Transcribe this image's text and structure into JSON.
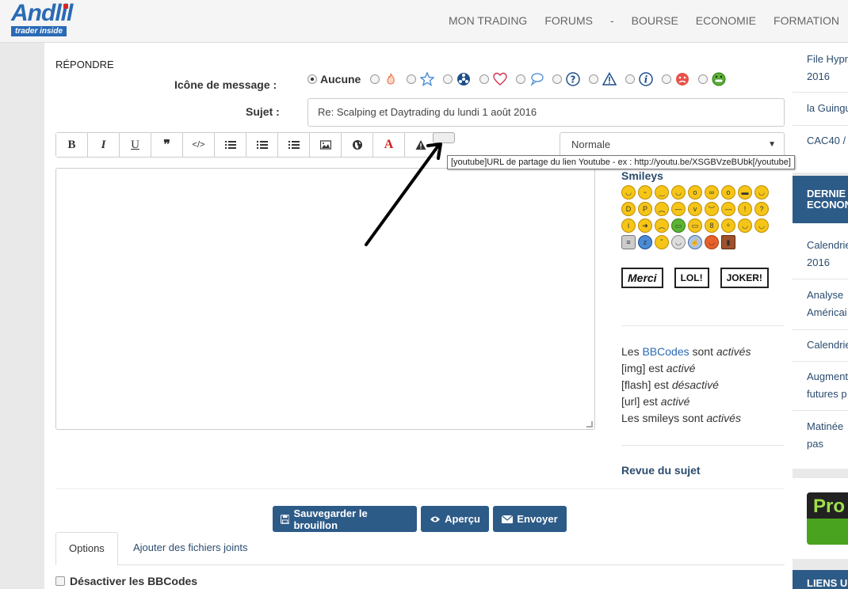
{
  "logo": {
    "line1": "Andlil",
    "line2": "trader inside"
  },
  "nav": [
    "MON TRADING",
    "FORUMS",
    "-",
    "BOURSE",
    "ECONOMIE",
    "FORMATION"
  ],
  "form": {
    "title": "RÉPONDRE",
    "icon_label": "Icône de message :",
    "icon_none": "Aucune",
    "subject_label": "Sujet :",
    "subject_value": "Re: Scalping et Daytrading du lundi 1 août 2016",
    "font_size": "Normale",
    "tooltip": "[youtube]URL de partage du lien Youtube - ex : http://youtu.be/XSGBVzeBUbk[/youtube]"
  },
  "toolbar": {
    "bold": "B",
    "italic": "I",
    "underline": "U",
    "quote": "❞",
    "code": "</>",
    "color": "A"
  },
  "smileys": {
    "title": "Smileys",
    "signs": [
      "Merci",
      "LOL!",
      "JOKER!"
    ]
  },
  "bbinfo": {
    "line1_prefix": "Les ",
    "line1_link": "BBCodes",
    "line1_mid": " sont ",
    "line1_state": "activés",
    "line2_prefix": "[img] est ",
    "line2_state": "activé",
    "line3_prefix": "[flash] est ",
    "line3_state": "désactivé",
    "line4_prefix": "[url] est ",
    "line4_state": "activé",
    "line5_prefix": "Les smileys sont ",
    "line5_state": "activés"
  },
  "revue": "Revue du sujet",
  "buttons": {
    "draft": "Sauvegarder le brouillon",
    "preview": "Aperçu",
    "send": "Envoyer"
  },
  "tabs": [
    "Options",
    "Ajouter des fichiers joints"
  ],
  "options": {
    "disable_bbcode": "Désactiver les BBCodes"
  },
  "sidebar": {
    "items_top": [
      "File Hypr",
      "2016",
      "la Guingu",
      "CAC40 /"
    ],
    "header1_l1": "DERNIE",
    "header1_l2": "ECONON",
    "items_mid": [
      "Calendrie",
      "2016",
      "Analyse",
      "Américai",
      "Calendrie",
      "Augment",
      "futures p",
      "Matinée",
      "pas"
    ],
    "promo": "Pro",
    "header2": "LIENS U"
  }
}
